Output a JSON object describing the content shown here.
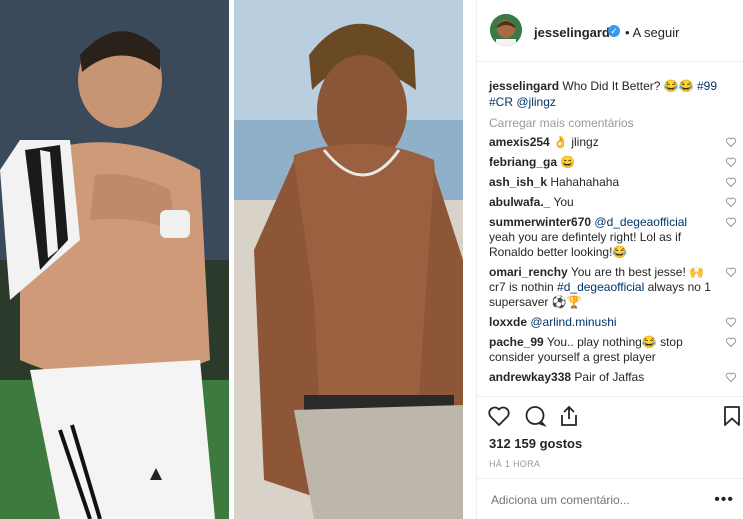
{
  "post": {
    "author": "jesselingard",
    "follow_label": "• A seguir",
    "caption": {
      "user": "jesselingard",
      "text": "Who Did It Better? 😂😂 ",
      "tags": "#99",
      "tags2": "#CR @jlingz"
    },
    "load_more": "Carregar mais comentários",
    "comments": [
      {
        "user": "amexis254",
        "text": "👌 jlingz"
      },
      {
        "user": "febriang_ga",
        "text": "😄"
      },
      {
        "user": "ash_ish_k",
        "text": "Hahahahaha"
      },
      {
        "user": "abulwafa._",
        "text": "You"
      },
      {
        "user": "summerwinter670",
        "mention": "@d_degeaofficial",
        "text": "yeah you are defintely right! Lol as if Ronaldo better looking!😂"
      },
      {
        "user": "omari_renchy",
        "text": "You are th best jesse! 🙌 cr7 is nothin ",
        "mention": "#d_degeaofficial",
        "text2": " always no 1 supersaver ⚽🏆"
      },
      {
        "user": "loxxde",
        "mention": "@arlind.minushi",
        "text": ""
      },
      {
        "user": "pache_99",
        "text": "You.. play nothing😂 stop consider yourself a grest player"
      },
      {
        "user": "andrewkay338",
        "text": "Pair of Jaffas"
      }
    ],
    "likes": "312 159 gostos",
    "time": "HÁ 1 HORA",
    "add_comment_placeholder": "Adiciona um comentário...",
    "more_options": "•••"
  },
  "colors": {
    "link": "#003569",
    "verified": "#3897f0",
    "muted": "#999999"
  },
  "icons": [
    "heart-icon",
    "comment-icon",
    "share-icon",
    "bookmark-icon",
    "verified-icon",
    "more-icon"
  ]
}
